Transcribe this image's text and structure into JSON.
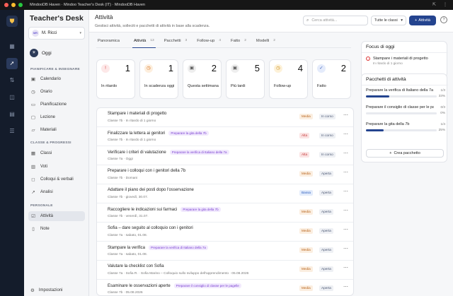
{
  "window": {
    "title": "MindooDB Haven · Mindoo Teacher's Desk (IT) · MindooDB Haven"
  },
  "brand": "Teacher's Desk",
  "user": {
    "initials": "MR",
    "name": "M. Ricci"
  },
  "sidebar": {
    "today_label": "Oggi",
    "section1": "PIANIFICARE & INSEGNARE",
    "items1": [
      {
        "label": "Calendario",
        "icon": "calendar-icon"
      },
      {
        "label": "Orario",
        "icon": "clock-icon"
      },
      {
        "label": "Pianificazione",
        "icon": "document-icon"
      },
      {
        "label": "Lezione",
        "icon": "slides-icon"
      },
      {
        "label": "Materiali",
        "icon": "folder-icon"
      }
    ],
    "section2": "CLASSE & PROGRESSI",
    "items2": [
      {
        "label": "Classi",
        "icon": "grid-icon"
      },
      {
        "label": "Voti",
        "icon": "chart-icon"
      },
      {
        "label": "Colloqui & verbali",
        "icon": "chat-icon"
      },
      {
        "label": "Analisi",
        "icon": "trend-icon"
      }
    ],
    "section3": "PERSONALE",
    "items3": [
      {
        "label": "Attività",
        "icon": "checklist-icon",
        "active": true
      },
      {
        "label": "Note",
        "icon": "note-icon"
      }
    ],
    "settings_label": "Impostazioni"
  },
  "header": {
    "title": "Attività",
    "subtitle": "Gestisci attività, solleciti e pacchetti di attività in base alla scadenza.",
    "search_placeholder": "Cerca attività...",
    "class_filter": "Tutte le classi",
    "add_label": "Attività"
  },
  "tabs": [
    {
      "label": "Panoramica",
      "count": ""
    },
    {
      "label": "Attività",
      "count": "13",
      "active": true
    },
    {
      "label": "Pacchetti",
      "count": "3"
    },
    {
      "label": "Follow-up",
      "count": "4"
    },
    {
      "label": "Fatto",
      "count": "2"
    },
    {
      "label": "Modelli",
      "count": "2"
    }
  ],
  "stats": [
    {
      "label": "In ritardo",
      "value": "1",
      "icon": "alert-icon",
      "color": "#d23b3b",
      "bg": "#fde8e8"
    },
    {
      "label": "In scadenza oggi",
      "value": "1",
      "icon": "clock-icon",
      "color": "#d46a12",
      "bg": "#fdeedd"
    },
    {
      "label": "Questa settimana",
      "value": "2",
      "icon": "calendar-icon",
      "color": "#555555",
      "bg": "#eeeeee"
    },
    {
      "label": "Più tardi",
      "value": "5",
      "icon": "calendar-icon",
      "color": "#555555",
      "bg": "#eeeeee"
    },
    {
      "label": "Follow-up",
      "value": "4",
      "icon": "clock-icon",
      "color": "#c8880e",
      "bg": "#fdf1d8"
    },
    {
      "label": "Fatto",
      "value": "2",
      "icon": "check-icon",
      "color": "#3c5fb8",
      "bg": "#e4ebfb"
    }
  ],
  "tasks": [
    {
      "title": "Stampare i materiali di progetto",
      "badge": "",
      "meta": "Classe 7b · In ritardo di 1 giorno",
      "priority": "Media",
      "status": "In corso"
    },
    {
      "title": "Finalizzare la lettera ai genitori",
      "badge": "Preparare la gita della 7b",
      "meta": "Classe 7b · In ritardo di 1 giorno",
      "priority": "Alta",
      "status": "In corso"
    },
    {
      "title": "Verificare i criteri di valutazione",
      "badge": "Preparare la verifica di Italiano della 7a",
      "meta": "Classe 7a · Oggi",
      "priority": "Alta",
      "status": "In corso"
    },
    {
      "title": "Preparare i colloqui con i genitori della 7b",
      "badge": "",
      "meta": "Classe 7b · Domani",
      "priority": "Media",
      "status": "Aperta"
    },
    {
      "title": "Adattare il piano dei posti dopo l'osservazione",
      "badge": "",
      "meta": "Classe 7b · giovedì, 30.07.",
      "priority": "Bassa",
      "status": "Aperta"
    },
    {
      "title": "Raccogliere le indicazioni sui farmaci",
      "badge": "Preparare la gita della 7b",
      "meta": "Classe 7b · venerdì, 31.07.",
      "priority": "Media",
      "status": "Aperta"
    },
    {
      "title": "Sofia – dare seguito al colloquio con i genitori",
      "badge": "",
      "meta": "Classe 7a · sabato, 01.08.",
      "priority": "Media",
      "status": "Aperta"
    },
    {
      "title": "Stampare la verifica",
      "badge": "Preparare la verifica di Italiano della 7a",
      "meta": "Classe 7a · sabato, 01.08.",
      "priority": "Media",
      "status": "Aperta"
    },
    {
      "title": "Valutare la checklist con Sofia",
      "badge": "",
      "meta": "Classe 7a · Sofia R. · Sofia Marino – Colloquio sullo sviluppo dell'apprendimento · 05.08.2026",
      "priority": "Media",
      "status": "Aperta"
    },
    {
      "title": "Esaminare le osservazioni aperte",
      "badge": "Preparare il consiglio di classe per le pagelle",
      "meta": "Classe 7b · 05.08.2026",
      "priority": "Media",
      "status": "Aperta"
    }
  ],
  "focus": {
    "title": "Focus di oggi",
    "item_title": "Stampare i materiali di progetto",
    "item_sub": "In ritardo di 1 giorno"
  },
  "packages": {
    "title": "Pacchetti di attività",
    "items": [
      {
        "title": "Preparare la verifica di Italiano della 7a",
        "count": "1/3",
        "percent": "33%",
        "progress": 0.33
      },
      {
        "title": "Preparare il consiglio di classe per le pagelle",
        "count": "0/3",
        "percent": "0%",
        "progress": 0
      },
      {
        "title": "Preparare la gita della 7b",
        "count": "1/4",
        "percent": "25%",
        "progress": 0.25
      }
    ],
    "create_label": "Crea pacchetto"
  }
}
